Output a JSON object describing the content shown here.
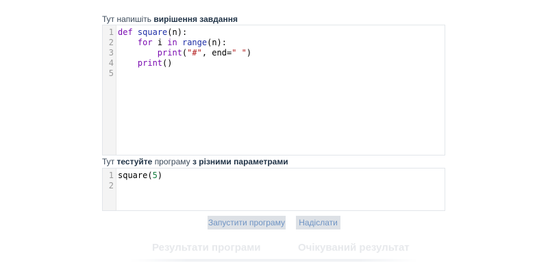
{
  "solution_label": {
    "prefix": "Тут напишіть",
    "bold": "вирішення завдання"
  },
  "solution_editor": {
    "line_numbers": [
      "1",
      "2",
      "3",
      "4",
      "5"
    ],
    "lines": [
      [
        {
          "t": "def",
          "c": "kw"
        },
        {
          "t": " "
        },
        {
          "t": "square",
          "c": "fn"
        },
        {
          "t": "(n):"
        }
      ],
      [
        {
          "t": "    "
        },
        {
          "t": "for",
          "c": "kw"
        },
        {
          "t": " i "
        },
        {
          "t": "in",
          "c": "kw"
        },
        {
          "t": " "
        },
        {
          "t": "range",
          "c": "fn"
        },
        {
          "t": "(n):"
        }
      ],
      [
        {
          "t": "        "
        },
        {
          "t": "print",
          "c": "kw"
        },
        {
          "t": "("
        },
        {
          "t": "\"#\"",
          "c": "str"
        },
        {
          "t": ", end="
        },
        {
          "t": "\" \"",
          "c": "str"
        },
        {
          "t": ")"
        }
      ],
      [
        {
          "t": "    "
        },
        {
          "t": "print",
          "c": "kw"
        },
        {
          "t": "()"
        }
      ],
      []
    ]
  },
  "test_label": {
    "prefix": "Тут",
    "bold1": "тестуйте",
    "middle": "програму",
    "bold2": "з різними параметрами"
  },
  "test_editor": {
    "line_numbers": [
      "1",
      "2"
    ],
    "lines": [
      [
        {
          "t": "square("
        },
        {
          "t": "5",
          "c": "num"
        },
        {
          "t": ")"
        }
      ],
      []
    ]
  },
  "buttons": {
    "run_label": "Запустити програму",
    "submit_label": "Надіслати"
  },
  "results": {
    "program_results_heading": "Результати програми",
    "expected_result_heading": "Очікуваний результат"
  },
  "colors": {
    "keyword": "#7a0bb0",
    "builtin": "#1f2fa6",
    "string": "#b11a1a",
    "number": "#0f7a3a",
    "button_bg": "#dde1e6",
    "button_text": "#6f94c4"
  }
}
